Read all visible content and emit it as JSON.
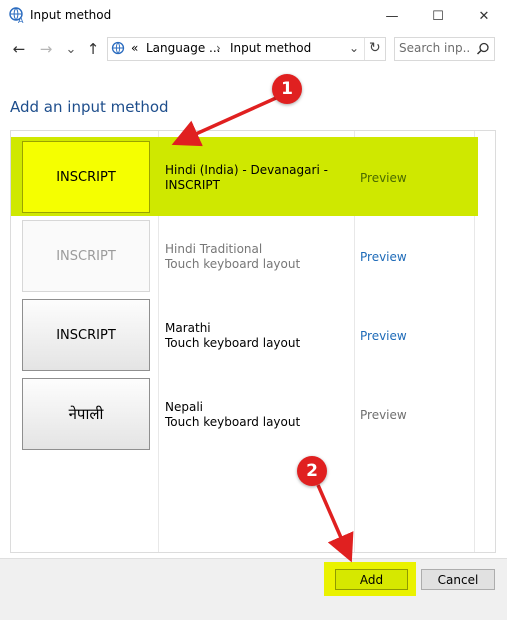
{
  "window": {
    "title": "Input method",
    "app_icon": "language-globe-icon",
    "controls": {
      "minimize": "—",
      "maximize": "☐",
      "close": "✕"
    }
  },
  "nav": {
    "back": "←",
    "forward": "→",
    "recent": "⌄",
    "up": "↑",
    "breadcrumb": {
      "prefix": "«",
      "parent": "Language ...",
      "separator": "›",
      "current": "Input method"
    },
    "dropdown": "⌄",
    "refresh": "↻",
    "search": {
      "placeholder": "Search inp...",
      "value": ""
    }
  },
  "heading": "Add an input method",
  "methods": [
    {
      "tile": "INSCRIPT",
      "line1": "Hindi (India) - Devanagari -",
      "line2": "INSCRIPT",
      "preview": "Preview",
      "state": "selected"
    },
    {
      "tile": "INSCRIPT",
      "line1": "Hindi Traditional",
      "line2": "Touch keyboard layout",
      "preview": "Preview",
      "state": "dim"
    },
    {
      "tile": "INSCRIPT",
      "line1": "Marathi",
      "line2": "Touch keyboard layout",
      "preview": "Preview",
      "state": "normal"
    },
    {
      "tile": "नेपाली",
      "line1": "Nepali",
      "line2": "Touch keyboard layout",
      "preview": "Preview",
      "state": "preview-disabled"
    }
  ],
  "footer": {
    "add": "Add",
    "cancel": "Cancel"
  },
  "annotations": {
    "step1": "1",
    "step2": "2",
    "color": "#e02020"
  },
  "colors": {
    "highlight": "#cfe800",
    "heading": "#1e4e8c",
    "link": "#1e6bb8"
  }
}
